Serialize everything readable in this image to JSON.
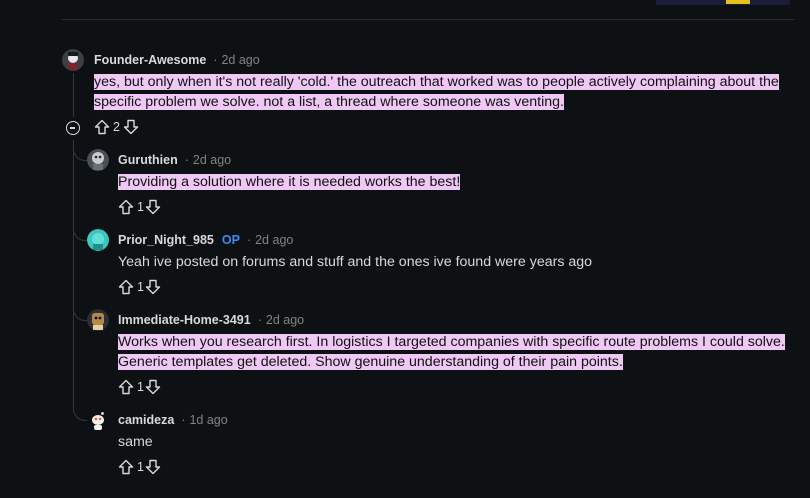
{
  "comments": [
    {
      "author": "Founder-Awesome",
      "op_badge": "",
      "time": "2d ago",
      "text": "yes, but only when it's not really 'cold.' the outreach that worked was to people actively complaining about the specific problem we solve. not a list, a thread where someone was venting.",
      "highlighted": true,
      "votes": "2"
    },
    {
      "author": "Guruthien",
      "op_badge": "",
      "time": "2d ago",
      "text": "Providing a solution where it is needed works the best!",
      "highlighted": true,
      "votes": "1"
    },
    {
      "author": "Prior_Night_985",
      "op_badge": "OP",
      "time": "2d ago",
      "text": "Yeah ive posted on forums and stuff and the ones ive found were years ago",
      "highlighted": false,
      "votes": "1"
    },
    {
      "author": "Immediate-Home-3491",
      "op_badge": "",
      "time": "2d ago",
      "text": "Works when you research first. In logistics I targeted companies with specific route problems I could solve. Generic templates get deleted. Show genuine understanding of their pain points.",
      "highlighted": true,
      "votes": "1"
    },
    {
      "author": "camideza",
      "op_badge": "",
      "time": "1d ago",
      "text": "same",
      "highlighted": false,
      "votes": "1"
    }
  ],
  "colors": {
    "background": "#0e1113",
    "highlight": "#f0c8f5",
    "op_badge": "#3d8cf0",
    "meta": "#818384"
  },
  "icons": {
    "upvote": "arrow-up-outline-icon",
    "downvote": "arrow-down-outline-icon",
    "collapse": "minus-circle-icon"
  }
}
